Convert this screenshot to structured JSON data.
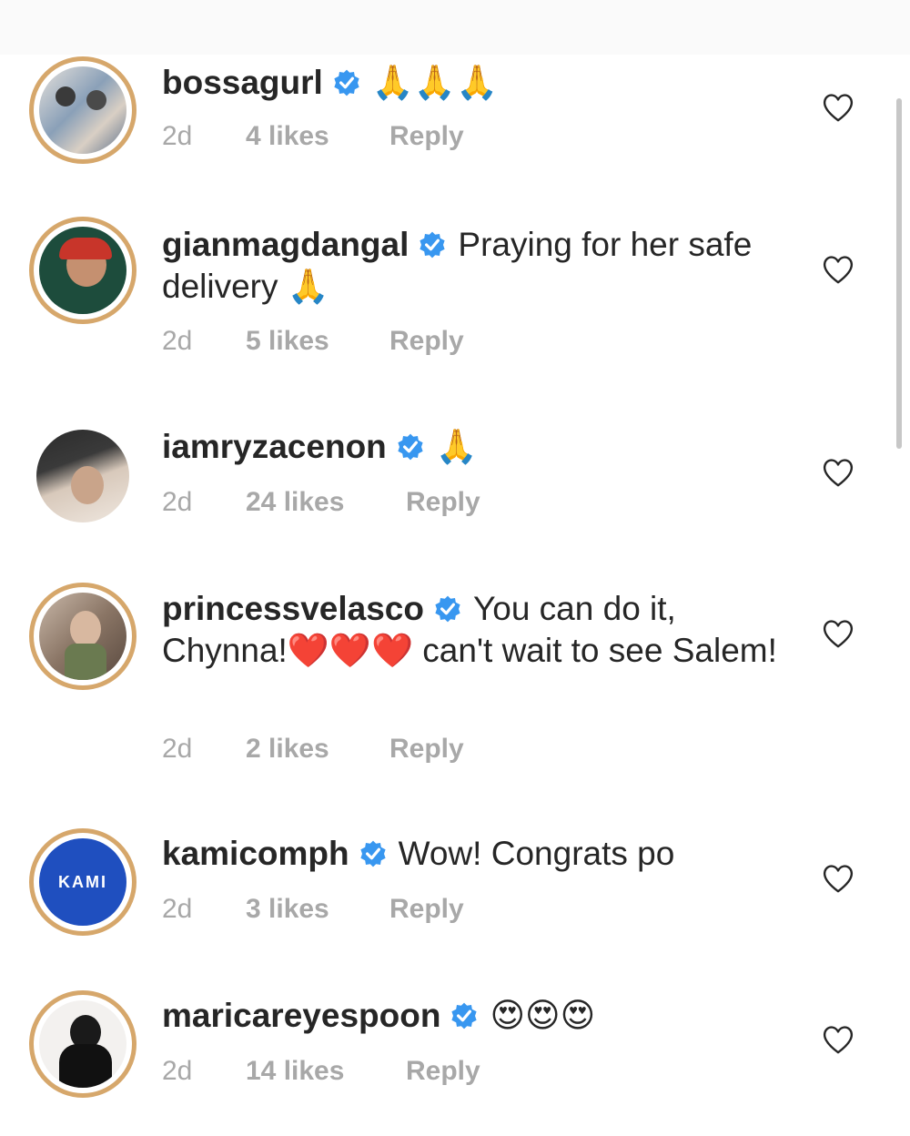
{
  "comments": [
    {
      "username": "bossagurl",
      "text": "🙏🙏🙏",
      "time": "2d",
      "likes": "4 likes",
      "reply": "Reply"
    },
    {
      "username": "gianmagdangal",
      "text": "Praying for her safe delivery 🙏",
      "time": "2d",
      "likes": "5 likes",
      "reply": "Reply"
    },
    {
      "username": "iamryzacenon",
      "text": "🙏",
      "time": "2d",
      "likes": "24 likes",
      "reply": "Reply"
    },
    {
      "username": "princessvelasco",
      "text": "You can do it, Chynna!❤️❤️❤️ can't wait to see Salem!",
      "time": "2d",
      "likes": "2 likes",
      "reply": "Reply"
    },
    {
      "username": "kamicomph",
      "text": "Wow! Congrats po",
      "time": "2d",
      "likes": "3 likes",
      "reply": "Reply",
      "avatar_text": "KAMI"
    },
    {
      "username": "maricareyespoon",
      "text": "😍😍😍",
      "time": "2d",
      "likes": "14 likes",
      "reply": "Reply"
    }
  ],
  "colors": {
    "verified": "#3897f0",
    "meta": "#a8a8a8",
    "text": "#262626",
    "avatar_ring": "#d6a76b",
    "kami_blue": "#1f4fbf"
  },
  "icons": {
    "verified": "verified-badge-icon",
    "like": "heart-icon"
  }
}
